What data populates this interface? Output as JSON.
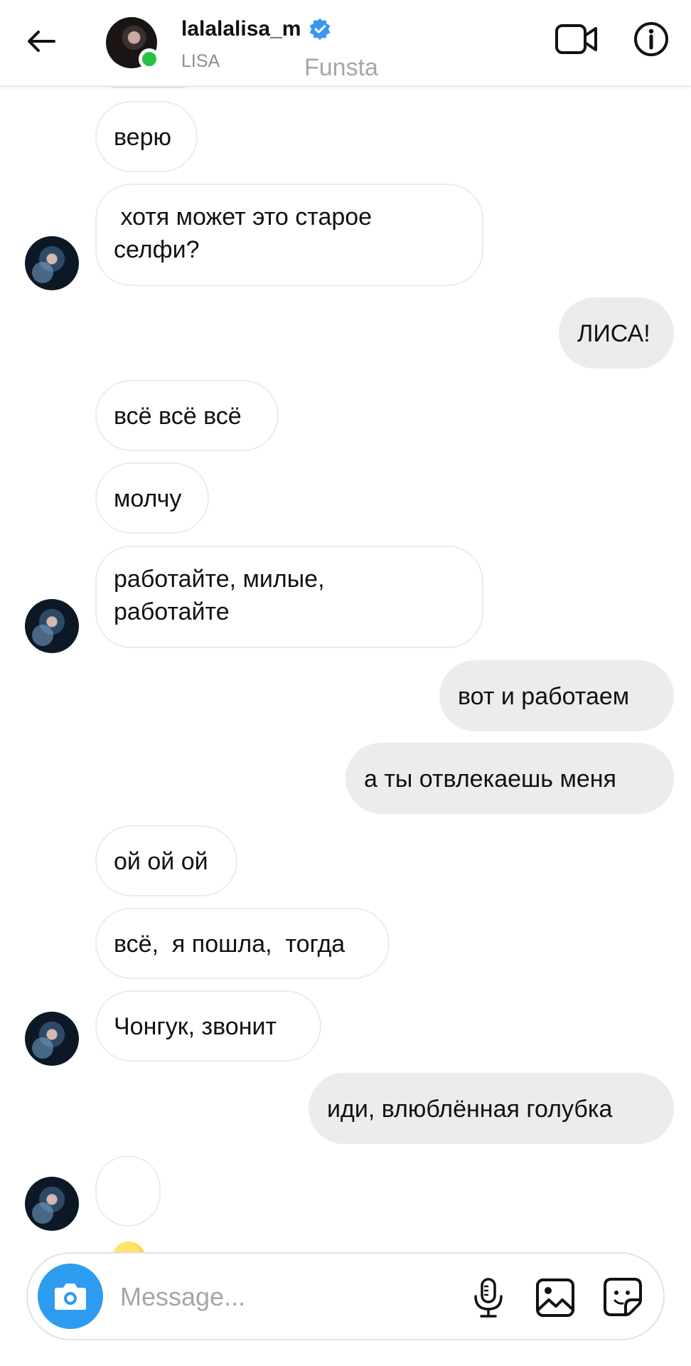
{
  "header": {
    "username": "lalalalisa_m",
    "subtitle": "LISA",
    "overlay_text": "Funsta"
  },
  "messages": [
    {
      "side": "in",
      "text": "верю"
    },
    {
      "side": "in",
      "text": " хотя может это старое\nселфи?"
    },
    {
      "side": "out",
      "text": "ЛИСА!"
    },
    {
      "side": "in",
      "text": "всё всё всё"
    },
    {
      "side": "in",
      "text": "молчу"
    },
    {
      "side": "in",
      "text": "работайте, милые,\nработайте"
    },
    {
      "side": "out",
      "text": "вот и работаем"
    },
    {
      "side": "out",
      "text": "а ты отвлекаешь меня"
    },
    {
      "side": "in",
      "text": "ой ой ой"
    },
    {
      "side": "in",
      "text": "всё,  я пошла,  тогда"
    },
    {
      "side": "in",
      "text": "Чонгук, звонит"
    },
    {
      "side": "out",
      "text": "иди, влюблённая голубка"
    },
    {
      "side": "in",
      "text": "",
      "emoji": "unamused-face"
    }
  ],
  "composer": {
    "placeholder": "Message..."
  },
  "icons": {
    "back": "arrow-left-icon",
    "verified": "verified-badge-icon",
    "video": "video-camera-icon",
    "info": "info-icon",
    "camera": "camera-icon",
    "mic": "microphone-icon",
    "gallery": "image-icon",
    "sticker": "sticker-icon"
  },
  "colors": {
    "accent_blue": "#2d9cf0",
    "online_green": "#27c146",
    "outgoing_bubble": "#ececec"
  }
}
